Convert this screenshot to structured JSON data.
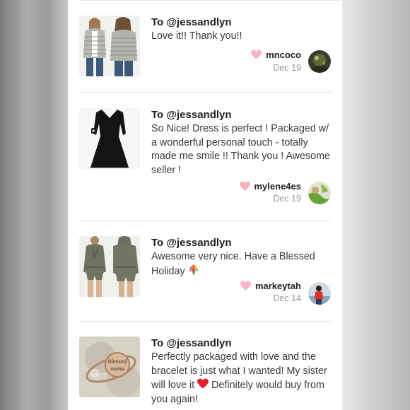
{
  "recipient_prefix": "To ",
  "reviews": [
    {
      "recipient": "@jessandlyn",
      "text": "Love it!! Thank you!!",
      "username": "mncoco",
      "date": "Dec 19",
      "thumb_icon": "gray-striped-cardigan-photo",
      "avatar_icon": "dark-landscape-avatar"
    },
    {
      "recipient": "@jessandlyn",
      "text": "So Nice! Dress is perfect ! Packaged w/ a wonderful personal touch - totally made me smile !! Thank you ! Awesome seller !",
      "username": "mylene4es",
      "date": "Dec 19",
      "thumb_icon": "black-dress-photo",
      "avatar_icon": "green-nature-avatar"
    },
    {
      "recipient": "@jessandlyn",
      "text": "Awesome very nice. Have a Blessed Holiday",
      "username": "markeytah",
      "date": "Dec 14",
      "thumb_icon": "olive-romper-photo",
      "avatar_icon": "person-red-top-avatar",
      "emoji": "bouquet-emoji"
    },
    {
      "recipient": "@jessandlyn",
      "text_before": "Perfectly packaged with love and the bracelet is just what I wanted! My sister will love it",
      "text_after": "Definitely would buy from you again!",
      "thumb_icon": "blessed-mama-bracelet-photo",
      "thumb_text": "blessed mama",
      "emoji": "red-heart-emoji"
    }
  ],
  "colors": {
    "heart": "#f8b4c0",
    "date": "#9a9a9a",
    "text": "#3a3a3a"
  }
}
